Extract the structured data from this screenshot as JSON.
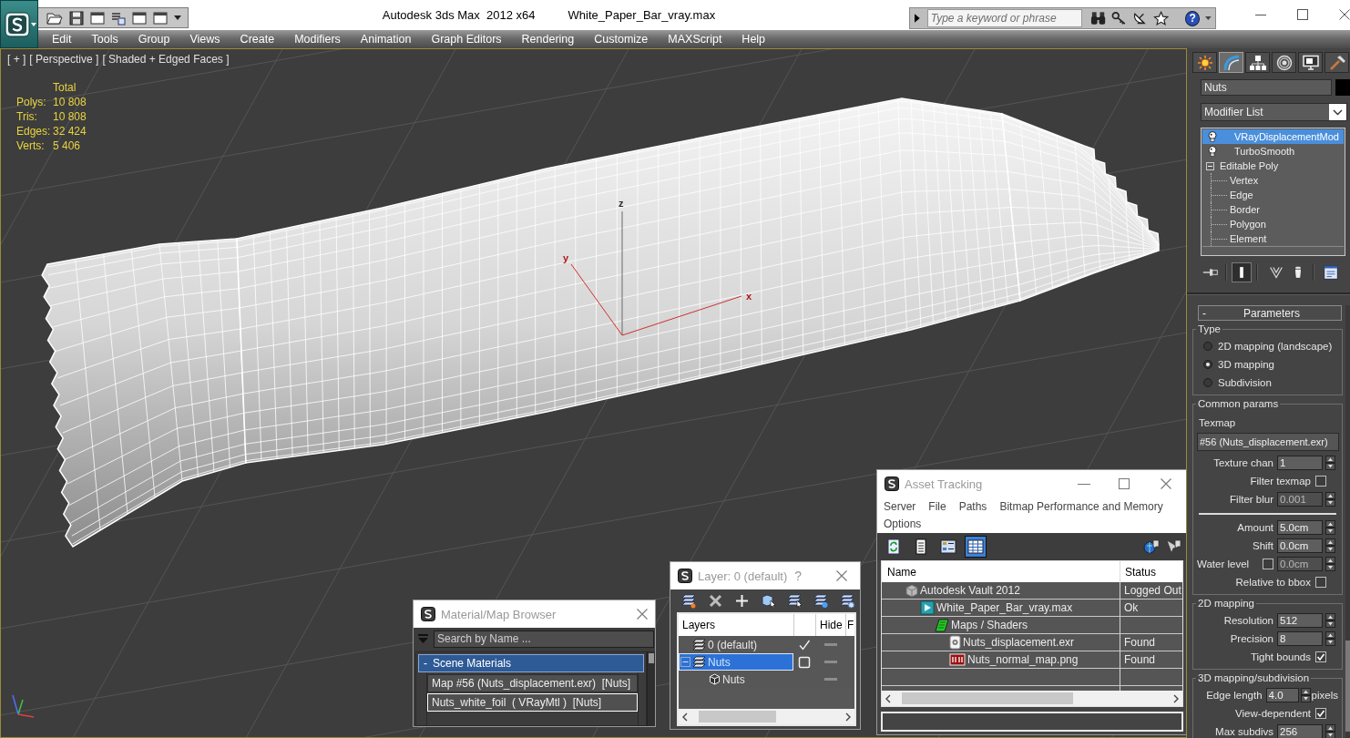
{
  "title_bar": {
    "app": "Autodesk 3ds Max  2012 x64",
    "file": "White_Paper_Bar_vray.max",
    "search_placeholder": "Type a keyword or phrase",
    "help": "?"
  },
  "menu": [
    "Edit",
    "Tools",
    "Group",
    "Views",
    "Create",
    "Modifiers",
    "Animation",
    "Graph Editors",
    "Rendering",
    "Customize",
    "MAXScript",
    "Help"
  ],
  "viewport": {
    "labels": [
      "[ + ]",
      "[ Perspective ]",
      "[ Shaded + Edged Faces ]"
    ],
    "stats_header": "Total",
    "stats": [
      {
        "label": "Polys:",
        "value": "10 808"
      },
      {
        "label": "Tris:",
        "value": "10 808"
      },
      {
        "label": "Edges:",
        "value": "32 424"
      },
      {
        "label": "Verts:",
        "value": "5 406"
      }
    ],
    "gizmo_axes": [
      "z",
      "y",
      "x"
    ]
  },
  "command_panel": {
    "tabs": [
      {
        "kind": "create",
        "selected": false
      },
      {
        "kind": "modify",
        "selected": true
      },
      {
        "kind": "hierarchy",
        "selected": false
      },
      {
        "kind": "motion",
        "selected": false
      },
      {
        "kind": "display",
        "selected": false
      },
      {
        "kind": "utilities",
        "selected": false
      }
    ],
    "object_name": "Nuts",
    "modifier_list": "Modifier List",
    "stack": [
      {
        "label": "VRayDisplacementMod",
        "kind": "modifier",
        "selected": true
      },
      {
        "label": "TurboSmooth",
        "kind": "modifier",
        "selected": false
      },
      {
        "label": "Editable Poly",
        "kind": "base",
        "selected": false,
        "expanded": true,
        "children": [
          {
            "label": "Vertex",
            "kind": "sub",
            "selected": false
          },
          {
            "label": "Edge",
            "kind": "sub",
            "selected": false
          },
          {
            "label": "Border",
            "kind": "sub",
            "selected": false
          },
          {
            "label": "Polygon",
            "kind": "sub",
            "selected": false
          },
          {
            "label": "Element",
            "kind": "sub",
            "selected": false
          }
        ]
      }
    ],
    "stack_tools": [
      {
        "kind": "pin",
        "on": false
      },
      {
        "kind": "end_result",
        "on": true
      },
      {
        "kind": "unique",
        "on": false
      },
      {
        "kind": "remove",
        "on": false
      },
      {
        "kind": "configure",
        "on": false
      }
    ]
  },
  "parameters": {
    "toggle": "-",
    "title": "Parameters",
    "groups": [
      {
        "title": "Type",
        "rows": [
          {
            "kind": "radio",
            "label": "2D mapping (landscape)",
            "selected": false
          },
          {
            "kind": "radio",
            "label": "3D mapping",
            "selected": true
          },
          {
            "kind": "radio",
            "label": "Subdivision",
            "selected": false
          }
        ]
      },
      {
        "title": "Common params",
        "rows": [
          {
            "kind": "label",
            "label": "Texmap"
          },
          {
            "kind": "map_button",
            "label": "#56 (Nuts_displacement.exr)"
          },
          {
            "kind": "spinner",
            "label": "Texture chan",
            "value": "1",
            "disabled": false
          },
          {
            "kind": "checkbox",
            "label": "Filter texmap",
            "checked": false
          },
          {
            "kind": "spinner",
            "label": "Filter blur",
            "value": "0.001",
            "disabled": true
          },
          {
            "kind": "divider"
          },
          {
            "kind": "spinner",
            "label": "Amount",
            "value": "5.0cm",
            "disabled": false
          },
          {
            "kind": "spinner",
            "label": "Shift",
            "value": "0.0cm",
            "disabled": false
          },
          {
            "kind": "check_spinner",
            "label": "Water level",
            "checked": false,
            "value": "0.0cm",
            "disabled": true
          },
          {
            "kind": "checkbox",
            "label": "Relative to bbox",
            "checked": false
          }
        ]
      },
      {
        "title": "2D mapping",
        "rows": [
          {
            "kind": "spinner",
            "label": "Resolution",
            "value": "512",
            "disabled": false
          },
          {
            "kind": "spinner",
            "label": "Precision",
            "value": "8",
            "disabled": false
          },
          {
            "kind": "checkbox",
            "label": "Tight bounds",
            "checked": true
          }
        ]
      },
      {
        "title": "3D mapping/subdivision",
        "rows": [
          {
            "kind": "spinner",
            "label": "Edge length",
            "value": "4.0",
            "unit": "pixels",
            "disabled": false
          },
          {
            "kind": "checkbox",
            "label": "View-dependent",
            "checked": true
          },
          {
            "kind": "spinner",
            "label": "Max subdivs",
            "value": "256",
            "disabled": false
          }
        ]
      }
    ]
  },
  "material_browser": {
    "title": "Material/Map Browser",
    "search_placeholder": "Search by Name ...",
    "groups": [
      {
        "toggle": "-",
        "title": "Scene Materials",
        "items": [
          {
            "label": "Map #56 (Nuts_displacement.exr)  [Nuts]",
            "selected": false
          },
          {
            "label": "Nuts_white_foil  ( VRayMtl )  [Nuts]",
            "selected": true
          }
        ]
      }
    ]
  },
  "layer_window": {
    "title": "Layer: 0 (default)",
    "help": "?",
    "columns": [
      "Layers",
      "Hide",
      "F"
    ],
    "layers": [
      {
        "name": "0 (default)",
        "kind": "layer",
        "current": true,
        "selected": false
      },
      {
        "name": "Nuts",
        "kind": "layer",
        "current": false,
        "selected": true,
        "expanded": true,
        "children": [
          {
            "name": "Nuts",
            "kind": "object",
            "selected": false
          }
        ]
      }
    ]
  },
  "asset_tracking": {
    "title": "Asset Tracking",
    "menu": [
      "Server",
      "File",
      "Paths",
      "Bitmap Performance and Memory",
      "Options"
    ],
    "toolbar": [
      {
        "kind": "refresh",
        "selected": false
      },
      {
        "kind": "list",
        "selected": false
      },
      {
        "kind": "thumbnails",
        "selected": false
      },
      {
        "kind": "table",
        "selected": true
      }
    ],
    "columns": [
      "Name",
      "Status"
    ],
    "rows": [
      {
        "name": "Autodesk Vault 2012",
        "status": "Logged Out",
        "kind": "vault",
        "children": [
          {
            "name": "White_Paper_Bar_vray.max",
            "status": "Ok",
            "kind": "scene",
            "children": [
              {
                "name": "Maps / Shaders",
                "kind": "folder",
                "children": [
                  {
                    "name": "Nuts_displacement.exr",
                    "status": "Found",
                    "kind": "image"
                  },
                  {
                    "name": "Nuts_normal_map.png",
                    "status": "Found",
                    "kind": "png"
                  }
                ]
              }
            ]
          }
        ]
      }
    ]
  }
}
